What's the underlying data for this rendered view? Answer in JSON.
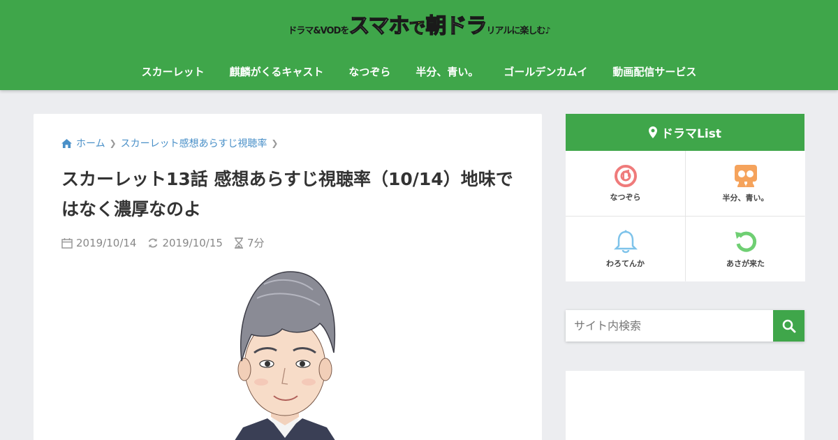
{
  "header": {
    "logo": {
      "part1": "ドラマ&VODを",
      "part2": "スマホ",
      "part3": "で",
      "part4": "朝ドラ",
      "part5": "リアルに楽しむ♪"
    },
    "nav": [
      "スカーレット",
      "麒麟がくるキャスト",
      "なつぞら",
      "半分、青い。",
      "ゴールデンカムイ",
      "動画配信サービス"
    ]
  },
  "breadcrumb": {
    "home": "ホーム",
    "category": "スカーレット感想あらすじ視聴率"
  },
  "article": {
    "title": "スカーレット13話 感想あらすじ視聴率（10/14）地味ではなく濃厚なのよ",
    "published": "2019/10/14",
    "updated": "2019/10/15",
    "read_time": "7分"
  },
  "sidebar": {
    "list_title": "ドラマList",
    "items": [
      {
        "label": "なつぞら",
        "icon": "music-disc-icon",
        "color": "#ef7b7b"
      },
      {
        "label": "半分、青い。",
        "icon": "people-icon",
        "color": "#f5a35c"
      },
      {
        "label": "わろてんか",
        "icon": "bell-icon",
        "color": "#7ec3ea"
      },
      {
        "label": "あさが来た",
        "icon": "refresh-icon",
        "color": "#6fcf73"
      }
    ],
    "search_placeholder": "サイト内検索"
  },
  "colors": {
    "brand_green": "#3fa64a",
    "link_blue": "#4a90c8"
  }
}
